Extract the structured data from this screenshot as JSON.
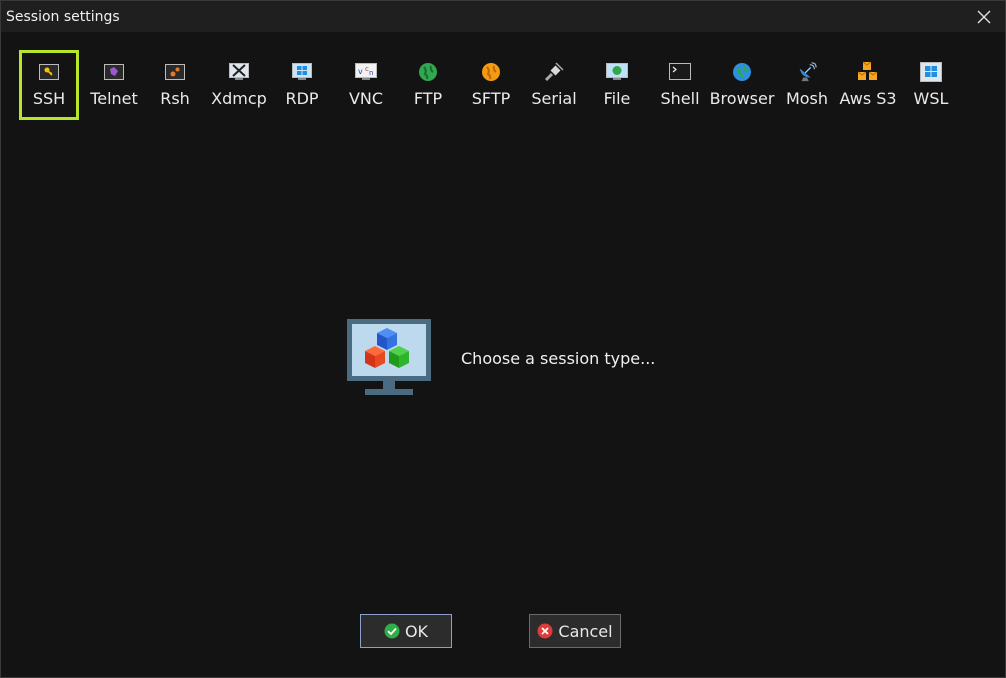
{
  "window": {
    "title": "Session settings"
  },
  "session_types": [
    {
      "label": "SSH",
      "icon": "key-icon",
      "selected": true
    },
    {
      "label": "Telnet",
      "icon": "telnet-icon"
    },
    {
      "label": "Rsh",
      "icon": "rsh-icon"
    },
    {
      "label": "Xdmcp",
      "icon": "xdmcp-icon"
    },
    {
      "label": "RDP",
      "icon": "rdp-icon"
    },
    {
      "label": "VNC",
      "icon": "vnc-icon"
    },
    {
      "label": "FTP",
      "icon": "ftp-globe-icon"
    },
    {
      "label": "SFTP",
      "icon": "sftp-globe-icon"
    },
    {
      "label": "Serial",
      "icon": "serial-plug-icon"
    },
    {
      "label": "File",
      "icon": "file-monitor-icon"
    },
    {
      "label": "Shell",
      "icon": "shell-terminal-icon"
    },
    {
      "label": "Browser",
      "icon": "browser-globe-icon"
    },
    {
      "label": "Mosh",
      "icon": "satellite-dish-icon"
    },
    {
      "label": "Aws S3",
      "icon": "aws-cubes-icon"
    },
    {
      "label": "WSL",
      "icon": "windows-logo-icon"
    }
  ],
  "main": {
    "prompt": "Choose a session type..."
  },
  "buttons": {
    "ok": "OK",
    "cancel": "Cancel"
  },
  "colors": {
    "selection_border": "#b7e628",
    "background": "#131313",
    "titlebar": "#1f1f1f"
  }
}
